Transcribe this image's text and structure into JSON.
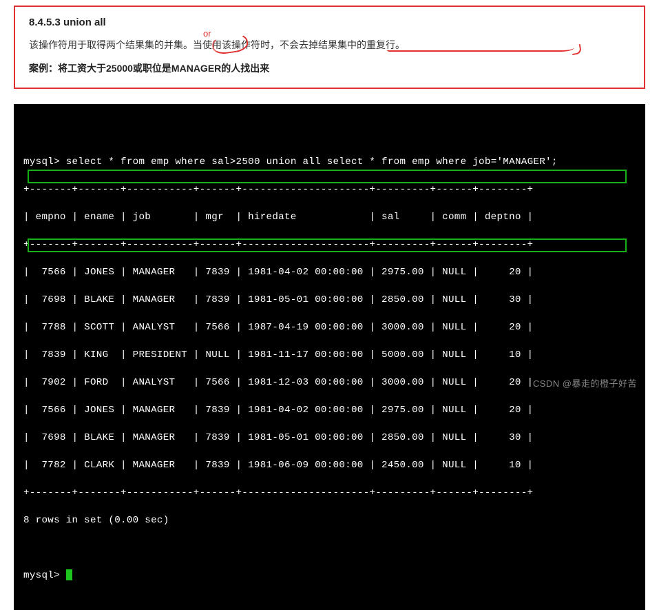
{
  "doc": {
    "heading": "8.4.5.3 union all",
    "paragraph_pre": "该操作符用于取得两个结果集的",
    "paragraph_union": "并集",
    "paragraph_mid": "。当使用该操作符时，",
    "paragraph_tail": "不会去掉结果集中的重复行。",
    "case_label": "案例：将工资大于25000或职位是MANAGER的人找出来",
    "annotation_or": "or"
  },
  "terminal": {
    "prompt": "mysql>",
    "query": "select * from emp where sal>2500 union all select * from emp where job='MANAGER';",
    "sep": "+-------+-------+-----------+------+---------------------+---------+------+--------+",
    "header": "| empno | ename | job       | mgr  | hiredate            | sal     | comm | deptno |",
    "rows": [
      "|  7566 | JONES | MANAGER   | 7839 | 1981-04-02 00:00:00 | 2975.00 | NULL |     20 |",
      "|  7698 | BLAKE | MANAGER   | 7839 | 1981-05-01 00:00:00 | 2850.00 | NULL |     30 |",
      "|  7788 | SCOTT | ANALYST   | 7566 | 1987-04-19 00:00:00 | 3000.00 | NULL |     20 |",
      "|  7839 | KING  | PRESIDENT | NULL | 1981-11-17 00:00:00 | 5000.00 | NULL |     10 |",
      "|  7902 | FORD  | ANALYST   | 7566 | 1981-12-03 00:00:00 | 3000.00 | NULL |     20 |",
      "|  7566 | JONES | MANAGER   | 7839 | 1981-04-02 00:00:00 | 2975.00 | NULL |     20 |",
      "|  7698 | BLAKE | MANAGER   | 7839 | 1981-05-01 00:00:00 | 2850.00 | NULL |     30 |",
      "|  7782 | CLARK | MANAGER   | 7839 | 1981-06-09 00:00:00 | 2450.00 | NULL |     10 |"
    ],
    "footer": "8 rows in set (0.00 sec)"
  },
  "watermark": "CSDN @暴走的橙子好苦"
}
